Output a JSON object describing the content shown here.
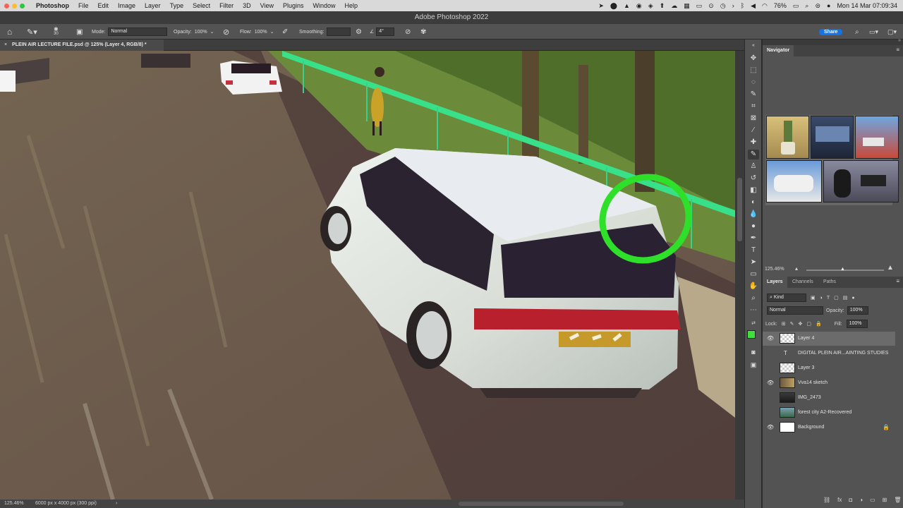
{
  "menubar": {
    "app": "Photoshop",
    "items": [
      "File",
      "Edit",
      "Image",
      "Layer",
      "Type",
      "Select",
      "Filter",
      "3D",
      "View",
      "Plugins",
      "Window",
      "Help"
    ],
    "battery": "76%",
    "datetime": "Mon 14 Mar  07:09:34"
  },
  "window": {
    "title": "Adobe Photoshop 2022"
  },
  "options": {
    "brush_size": "30",
    "mode_label": "Mode:",
    "mode_value": "Normal",
    "opacity_label": "Opacity:",
    "opacity_value": "100%",
    "flow_label": "Flow:",
    "flow_value": "100%",
    "smoothing_label": "Smoothing:",
    "smoothing_value": "",
    "angle_value": "4°",
    "share_label": "Share"
  },
  "document": {
    "tab_title": "PLEIN AIR LECTURE FILE.psd @ 125% (Layer 4, RGB/8) *",
    "zoom": "125.46%",
    "info": "6000 px x 4000 px (300 ppi)"
  },
  "navigator": {
    "title": "Navigator",
    "zoom": "125.46%"
  },
  "layers_panel": {
    "tabs": [
      "Layers",
      "Channels",
      "Paths"
    ],
    "filter_kind": "Kind",
    "blend_mode": "Normal",
    "opacity_label": "Opacity:",
    "opacity_value": "100%",
    "lock_label": "Lock:",
    "fill_label": "Fill:",
    "fill_value": "100%",
    "layers": [
      {
        "name": "Layer 4",
        "visible": true,
        "selected": true
      },
      {
        "name": "DIGITAL PLEIN AIR...AINTING STUDIES",
        "visible": false,
        "type": "text"
      },
      {
        "name": "Layer 3",
        "visible": false
      },
      {
        "name": "Vva14 sketch",
        "visible": true
      },
      {
        "name": "IMG_2473",
        "visible": false
      },
      {
        "name": "forest city A2-Recovered",
        "visible": false
      },
      {
        "name": "Background",
        "visible": true,
        "locked": true
      }
    ]
  },
  "colors": {
    "foreground": "#3ee03a",
    "background": "#ffffff",
    "accent": "#1473e6"
  }
}
